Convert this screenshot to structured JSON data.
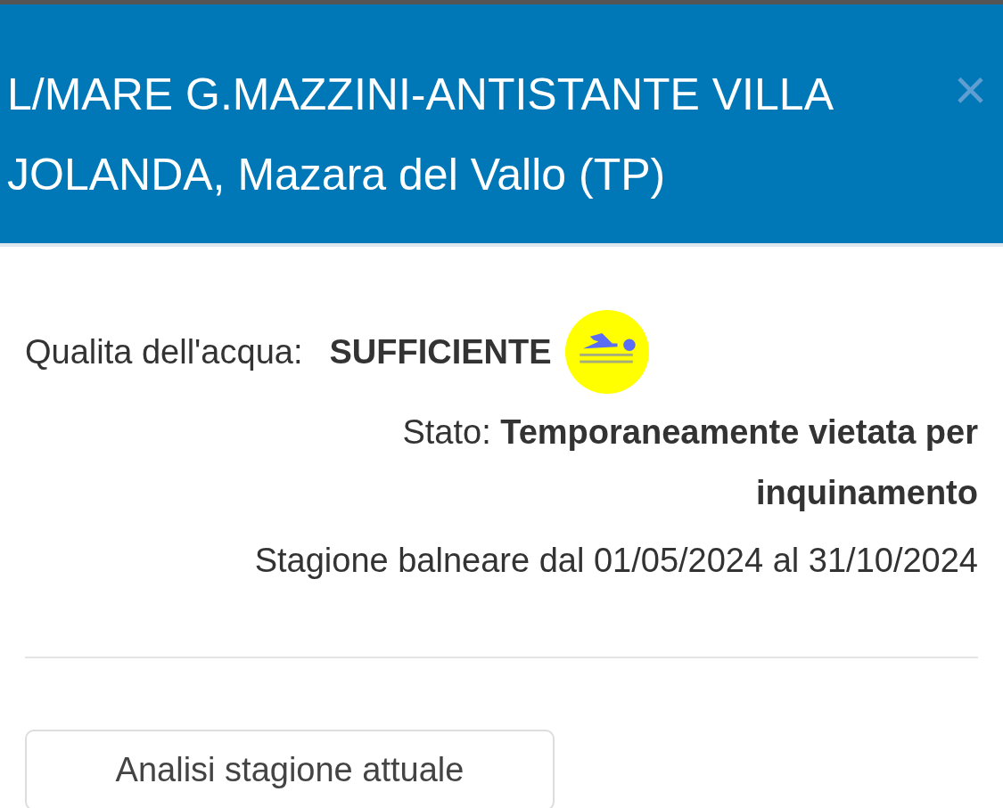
{
  "header": {
    "title": "L/MARE G.MAZZINI-ANTISTANTE VILLA JOLANDA, Mazara del Vallo (TP)",
    "close": "×"
  },
  "quality": {
    "label": "Qualita dell'acqua:",
    "value": "SUFFICIENTE"
  },
  "status": {
    "label": "Stato:",
    "value": "Temporaneamente vietata per inquinamento"
  },
  "season": "Stagione balneare dal 01/05/2024 al 31/10/2024",
  "buttons": [
    "Analisi stagione attuale"
  ]
}
